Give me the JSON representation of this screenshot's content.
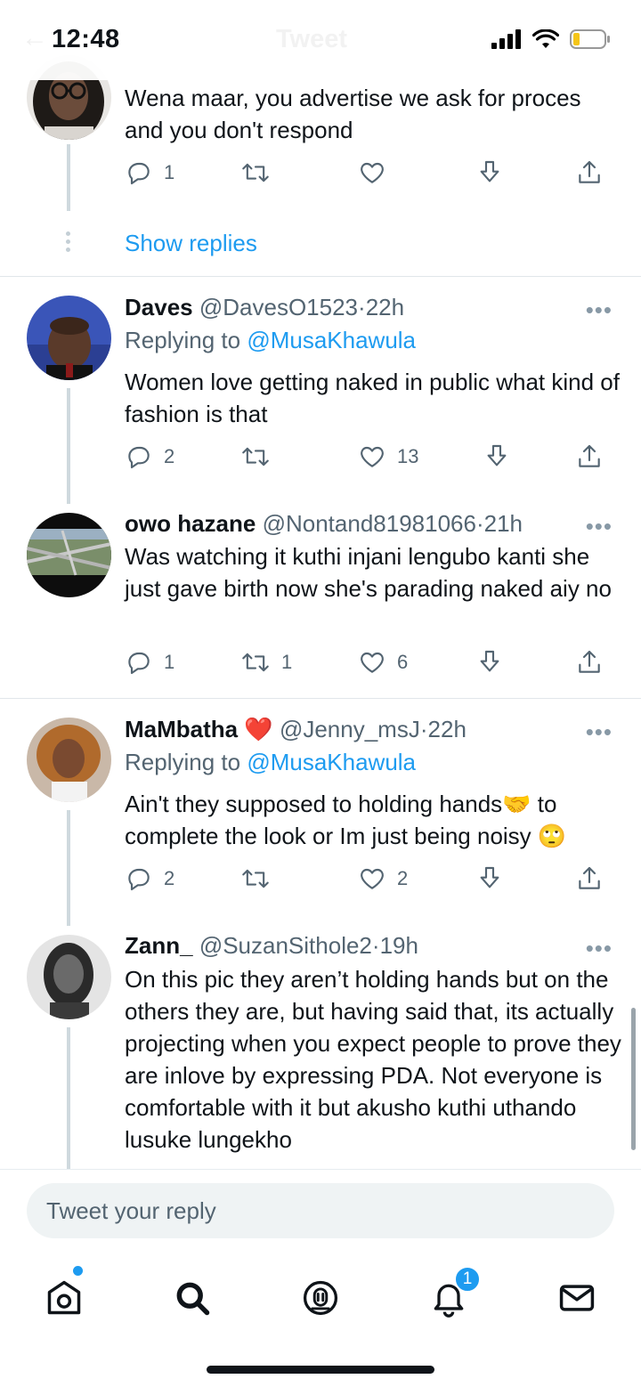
{
  "status_bar": {
    "time": "12:48",
    "ghost_title": "Tweet"
  },
  "show_replies": "Show replies",
  "tweets": [
    {
      "body": "Wena maar, you advertise we ask for proces and you don't respond",
      "reply_count": "1",
      "retweet_count": "",
      "like_count": ""
    },
    {
      "name": "Daves",
      "handle": "@DavesO1523",
      "dot": "·",
      "time": "22h",
      "replying_prefix": "Replying to",
      "replying_to": "@MusaKhawula",
      "body": "Women love getting naked in public what kind of fashion is that",
      "reply_count": "2",
      "retweet_count": "",
      "like_count": "13"
    },
    {
      "name": "owo hazane",
      "handle": "@Nontand81981066",
      "dot": "·",
      "time": "21h",
      "body": "Was watching it kuthi injani lengubo kanti she just gave birth now she's parading naked aiy no",
      "reply_count": "1",
      "retweet_count": "1",
      "like_count": "6"
    },
    {
      "name": "MaMbatha ❤️",
      "handle": "@Jenny_msJ",
      "dot": "·",
      "time": "22h",
      "replying_prefix": "Replying to",
      "replying_to": "@MusaKhawula",
      "body": "Ain't they supposed to holding hands🤝 to complete the look or Im just being noisy 🙄",
      "reply_count": "2",
      "retweet_count": "",
      "like_count": "2"
    },
    {
      "name": "Zann_",
      "handle": "@SuzanSithole2",
      "dot": "·",
      "time": "19h",
      "body": "On this pic they aren’t holding hands but on the others they are, but having said that, its actually projecting when you expect people to prove they are inlove by expressing PDA. Not everyone is comfortable with it but akusho kuthi uthando lusuke lungekho"
    }
  ],
  "more_glyph": "•••",
  "reply_box": {
    "placeholder": "Tweet your reply"
  },
  "tabbar": {
    "notification_badge": "1"
  },
  "colors": {
    "accent": "#1d9bf0",
    "secondary_text": "#536471",
    "thread_line": "#cfd9de"
  }
}
